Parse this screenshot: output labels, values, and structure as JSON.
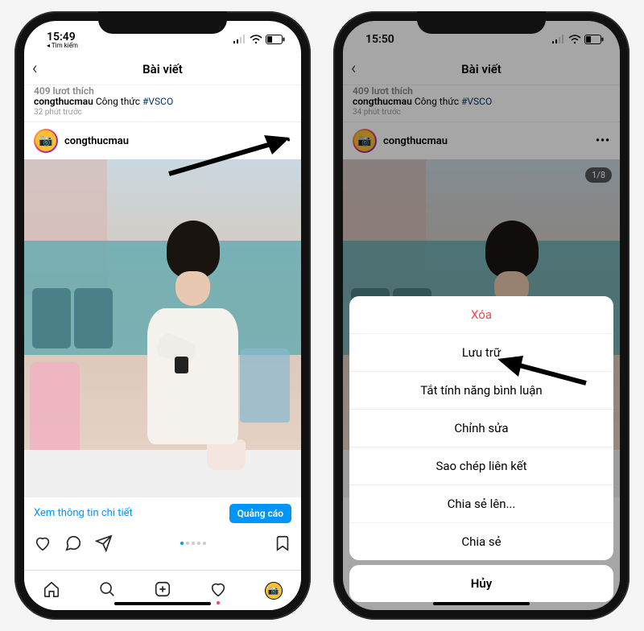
{
  "phone1": {
    "status_time": "15:49",
    "status_sub": "◂ Tìm kiếm",
    "header_title": "Bài viết",
    "likes": "409 lượt thích",
    "caption_user": "congthucmau",
    "caption_text": "Công thức ",
    "hashtag": "#VSCO",
    "time": "32 phút trước",
    "username": "congthucmau",
    "detail_link": "Xem thông tin chi tiết",
    "ad_button": "Quảng cáo"
  },
  "phone2": {
    "status_time": "15:50",
    "header_title": "Bài viết",
    "likes": "409 lượt thích",
    "caption_user": "congthucmau",
    "caption_text": "Công thức ",
    "hashtag": "#VSCO",
    "time": "34 phút trước",
    "username": "congthucmau",
    "page_badge": "1/8",
    "sheet": {
      "delete": "Xóa",
      "archive": "Lưu trữ",
      "comments_off": "Tắt tính năng bình luận",
      "edit": "Chỉnh sửa",
      "copy_link": "Sao chép liên kết",
      "share_to": "Chia sẻ lên...",
      "share": "Chia sẻ",
      "cancel": "Hủy"
    }
  }
}
